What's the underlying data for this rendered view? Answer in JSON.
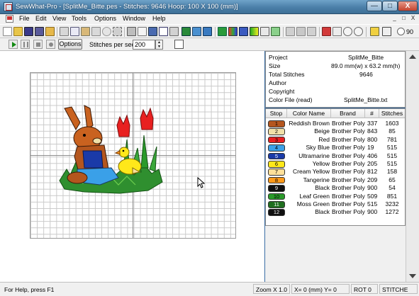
{
  "window": {
    "title": "SewWhat-Pro - [SplitMe_Bitte.pes - Stitches: 9646  Hoop: 100 X 100 (mm)]",
    "minimize": "—",
    "maximize": "□",
    "close": "X"
  },
  "menu": [
    "File",
    "Edit",
    "View",
    "Tools",
    "Options",
    "Window",
    "Help"
  ],
  "mdi_controls": [
    "_",
    "□",
    "X"
  ],
  "toolbar": {
    "icons": [
      "new-icon",
      "open-icon",
      "save-icon",
      "save-as-icon",
      "export-icon",
      "cut-icon",
      "copy-icon",
      "paste-icon",
      "delete-icon",
      "undo-icon",
      "select-all-icon",
      "print-icon",
      "print-preview-icon",
      "book-icon",
      "text-icon",
      "hoop-icon",
      "monitor-icon",
      "email-icon",
      "green-block-icon",
      "color-palette-icon",
      "blue-block-icon",
      "gradient-icon",
      "grid-icon",
      "fill-icon",
      "sew-icon",
      "thread-icon",
      "thread-lines-icon",
      "split-icon",
      "red-grid-icon",
      "move-icon",
      "zoom-in-icon",
      "zoom-out-icon",
      "help-icon",
      "pointer-icon"
    ],
    "rotate_label": "90"
  },
  "playback": {
    "options_label": "Options",
    "stitches_per_sec_label": "Stitches per sec",
    "stitches_per_sec_value": "200"
  },
  "info": {
    "rows": [
      {
        "label": "Project",
        "value": "SplitMe_Bitte"
      },
      {
        "label": "Size",
        "value": "89.0 mm(w) x 63.2 mm(h)"
      },
      {
        "label": "Total Stitches",
        "value": "9646"
      },
      {
        "label": "Author",
        "value": ""
      },
      {
        "label": "Copyright",
        "value": ""
      },
      {
        "label": "Color File (read)",
        "value": "SplitMe_Bitte.txt"
      }
    ]
  },
  "color_list": {
    "headers": [
      "Stop",
      "Color Name",
      "Brand",
      "#",
      "Stitches"
    ],
    "rows": [
      {
        "stop": "1",
        "name": "Reddish Brown",
        "brand": "Brother Poly",
        "num": "337",
        "stitches": "1603",
        "color": "#b4561e",
        "fg": "#000"
      },
      {
        "stop": "2",
        "name": "Beige",
        "brand": "Brother Poly",
        "num": "843",
        "stitches": "85",
        "color": "#f0e0a8",
        "fg": "#000"
      },
      {
        "stop": "3",
        "name": "Red",
        "brand": "Brother Poly",
        "num": "800",
        "stitches": "781",
        "color": "#e82020",
        "fg": "#000"
      },
      {
        "stop": "4",
        "name": "Sky Blue",
        "brand": "Brother Poly",
        "num": "19",
        "stitches": "515",
        "color": "#3aa0e8",
        "fg": "#000"
      },
      {
        "stop": "5",
        "name": "Ultramarine",
        "brand": "Brother Poly",
        "num": "406",
        "stitches": "515",
        "color": "#1a3aa8",
        "fg": "#fff"
      },
      {
        "stop": "6",
        "name": "Yellow",
        "brand": "Brother Poly",
        "num": "205",
        "stitches": "515",
        "color": "#ffe81a",
        "fg": "#000"
      },
      {
        "stop": "7",
        "name": "Cream Yellow",
        "brand": "Brother Poly",
        "num": "812",
        "stitches": "158",
        "color": "#ffe09a",
        "fg": "#000"
      },
      {
        "stop": "8",
        "name": "Tangerine",
        "brand": "Brother Poly",
        "num": "209",
        "stitches": "65",
        "color": "#ff9a1a",
        "fg": "#000"
      },
      {
        "stop": "9",
        "name": "Black",
        "brand": "Brother Poly",
        "num": "900",
        "stitches": "54",
        "color": "#101010",
        "fg": "#fff"
      },
      {
        "stop": "10",
        "name": "Leaf Green",
        "brand": "Brother Poly",
        "num": "509",
        "stitches": "851",
        "color": "#2a9a2a",
        "fg": "#000"
      },
      {
        "stop": "11",
        "name": "Moss Green",
        "brand": "Brother Poly",
        "num": "515",
        "stitches": "3232",
        "color": "#1e6e1e",
        "fg": "#fff"
      },
      {
        "stop": "12",
        "name": "Black",
        "brand": "Brother Poly",
        "num": "900",
        "stitches": "1272",
        "color": "#101010",
        "fg": "#fff"
      }
    ]
  },
  "status": {
    "help": "For Help, press F1",
    "zoom": "Zoom X 1.0",
    "coords": "X=  0 (mm) Y=  0",
    "rot": "ROT  0",
    "stitch": "STITCHE"
  }
}
